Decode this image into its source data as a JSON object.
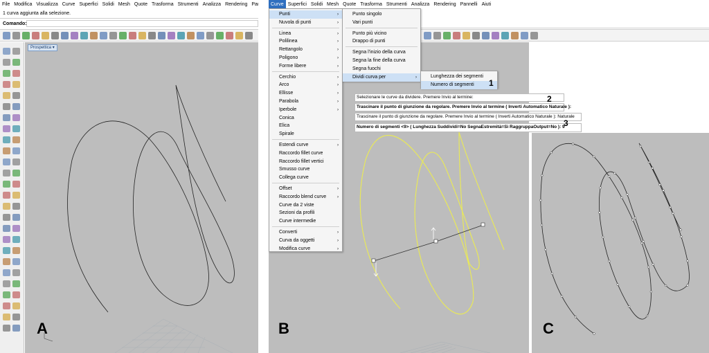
{
  "panel_a": {
    "menu": [
      "File",
      "Modifica",
      "Visualizza",
      "Curve",
      "Superfici",
      "Solidi",
      "Mesh",
      "Quote",
      "Trasforma",
      "Strumenti",
      "Analizza",
      "Rendering",
      "Pannell"
    ],
    "status_line": "1 curva aggiunta alla selezione.",
    "command_label": "Comando:",
    "viewport_tab": "Prospettica",
    "label": "A"
  },
  "panel_b": {
    "menu": [
      "Curve",
      "Superfici",
      "Solidi",
      "Mesh",
      "Quote",
      "Trasforma",
      "Strumenti",
      "Analizza",
      "Rendering",
      "Pannelli",
      "Aiuti"
    ],
    "curve_menu": [
      {
        "label": "Punti",
        "sub": true,
        "highlighted": true
      },
      {
        "label": "Nuvola di punti",
        "sub": true
      },
      {
        "label": "Linea",
        "sub": true
      },
      {
        "label": "Polilinea",
        "sub": true
      },
      {
        "label": "Rettangolo",
        "sub": true
      },
      {
        "label": "Poligono",
        "sub": true
      },
      {
        "label": "Forme libere",
        "sub": true
      },
      {
        "label": "Cerchio",
        "sub": true
      },
      {
        "label": "Arco",
        "sub": true
      },
      {
        "label": "Ellisse",
        "sub": true
      },
      {
        "label": "Parabola",
        "sub": true
      },
      {
        "label": "Iperbole",
        "sub": true
      },
      {
        "label": "Conica",
        "sub": false
      },
      {
        "label": "Elica",
        "sub": false
      },
      {
        "label": "Spirale",
        "sub": false
      },
      {
        "label": "Estendi curve",
        "sub": true
      },
      {
        "label": "Raccordo fillet curve",
        "sub": false
      },
      {
        "label": "Raccordo fillet vertici",
        "sub": false
      },
      {
        "label": "Smusso curve",
        "sub": false
      },
      {
        "label": "Collega curve",
        "sub": false
      },
      {
        "label": "Offset",
        "sub": true
      },
      {
        "label": "Raccordo blend curve",
        "sub": true
      },
      {
        "label": "Curve da 2 viste",
        "sub": false
      },
      {
        "label": "Sezioni da profili",
        "sub": false
      },
      {
        "label": "Curve intermedie",
        "sub": false
      },
      {
        "label": "Converti",
        "sub": true
      },
      {
        "label": "Curva da oggetti",
        "sub": true
      },
      {
        "label": "Modifica curve",
        "sub": true
      }
    ],
    "punti_menu": [
      {
        "label": "Punto singolo"
      },
      {
        "label": "Vari punti"
      },
      {
        "label": "Punto più vicino"
      },
      {
        "label": "Drappo di punti"
      },
      {
        "label": "Segna l'inizio della curva"
      },
      {
        "label": "Segna la fine della curva"
      },
      {
        "label": "Segna fuochi"
      },
      {
        "label": "Dividi curva per",
        "sub": true,
        "highlighted": true
      }
    ],
    "dividi_menu": [
      {
        "label": "Lunghezza dei segmenti"
      },
      {
        "label": "Numero di segmenti",
        "highlighted": true
      }
    ],
    "cmd_1": "Selezionare le curve da dividere. Premere Invio al termine:",
    "cmd_2": "Trascinare il punto di giunzione da regolare. Premere Invio al termine ( Inverti  Automatico  Naturale ):",
    "cmd_3": "Trascinare il punto di giunzione da regolare. Premere Invio al termine ( Inverti  Automatico  Naturale ): Naturale",
    "cmd_4": "Numero di segmenti <9> ( Lunghezza  Suddividi=No  SegnaEstremità=Sì  RaggruppaOutput=No ): 9",
    "step_1": "1",
    "step_2": "2",
    "step_3": "3",
    "label": "B"
  },
  "panel_c": {
    "label": "C"
  },
  "colors": {
    "viewport_bg": "#bdbdbd",
    "menu_highlight": "#2f6fbf",
    "item_highlight": "#cde0f5",
    "selected_curve": "#e8e85a"
  }
}
